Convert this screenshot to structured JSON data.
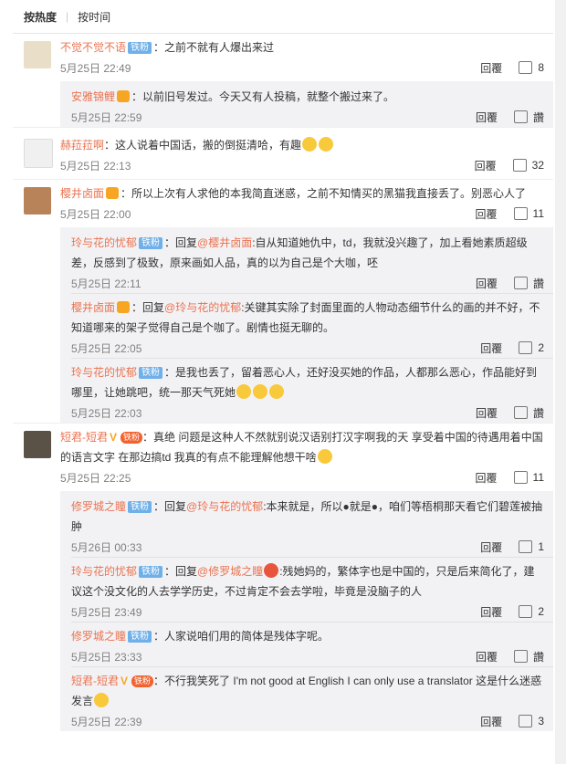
{
  "sort": {
    "hot": "按热度",
    "time": "按时间"
  },
  "comments": [
    {
      "name": "不觉不觉不语",
      "badge": "铁粉",
      "text": "：之前不就有人爆出来过",
      "time": "5月25日 22:49",
      "reply": "回覆",
      "likes": "8",
      "replies": [
        {
          "name": "安雅锦鲤",
          "badge": "",
          "text": "：以前旧号发过。今天又有人投稿，就整个搬过来了。",
          "time": "5月25日 22:59",
          "reply": "回覆",
          "likes": "讚"
        }
      ]
    },
    {
      "name": "赫菈菈啊",
      "badge": "",
      "text": "：这人说着中国话，搬的倒挺清哈，有趣",
      "time": "5月25日 22:13",
      "reply": "回覆",
      "likes": "32",
      "replies": []
    },
    {
      "name": "樱井卤面",
      "badge": "",
      "text": "：所以上次有人求他的本我简直迷惑，之前不知情买的黑猫我直接丢了。别恶心人了",
      "time": "5月25日 22:00",
      "reply": "回覆",
      "likes": "11",
      "replies": [
        {
          "name": "玲与花的忧郁",
          "badge": "铁粉",
          "pre": "：回复",
          "at": "@樱井卤面",
          "text": ":自从知道她仇中，td，我就没兴趣了，加上看她素质超级差，反感到了极致，原来画如人品，真的以为自己是个大咖，呸",
          "time": "5月25日 22:11",
          "reply": "回覆",
          "likes": "讚"
        },
        {
          "name": "樱井卤面",
          "badge": "",
          "pre": "：回复",
          "at": "@玲与花的忧郁",
          "text": ":关键其实除了封面里面的人物动态细节什么的画的并不好，不知道哪来的架子觉得自己是个咖了。剧情也挺无聊的。",
          "time": "5月25日 22:05",
          "reply": "回覆",
          "likes": "2"
        },
        {
          "name": "玲与花的忧郁",
          "badge": "铁粉",
          "pre": "",
          "at": "",
          "text": "：是我也丢了，留着恶心人，还好没买她的作品，人都那么恶心，作品能好到哪里，让她跳吧，统一那天气死她",
          "time": "5月25日 22:03",
          "reply": "回覆",
          "likes": "讚"
        }
      ]
    },
    {
      "name": "短君-短君",
      "badge": "",
      "fan": "铁粉",
      "text": "：真绝 问题是这种人不然就别说汉语别打汉字啊我的天 享受着中国的待遇用着中国的语言文字 在那边搞td 我真的有点不能理解他想干啥",
      "time": "5月25日 22:25",
      "reply": "回覆",
      "likes": "11",
      "replies": [
        {
          "name": "修罗城之瞳",
          "badge": "铁粉",
          "pre": "：回复",
          "at": "@玲与花的忧郁",
          "text": ":本来就是，所以●就是●，咱们等梧桐那天看它们碧莲被抽肿",
          "time": "5月26日 00:33",
          "reply": "回覆",
          "likes": "1"
        },
        {
          "name": "玲与花的忧郁",
          "badge": "铁粉",
          "pre": "：回复",
          "at": "@修罗城之瞳",
          "text": ":残她妈的，繁体字也是中国的，只是后来简化了，建议这个没文化的人去学学历史，不过肯定不会去学啦，毕竟是没脑子的人",
          "time": "5月25日 23:49",
          "reply": "回覆",
          "likes": "2"
        },
        {
          "name": "修罗城之瞳",
          "badge": "铁粉",
          "pre": "",
          "at": "",
          "text": "：人家说咱们用的简体是残体字呢。",
          "time": "5月25日 23:33",
          "reply": "回覆",
          "likes": "讚"
        },
        {
          "name": "短君-短君",
          "badge": "",
          "fan": "铁粉",
          "pre": "",
          "at": "",
          "text": "：不行我笑死了 I'm not good at English I can only use a translator 这是什么迷惑发言",
          "time": "5月25日 22:39",
          "reply": "回覆",
          "likes": "3"
        }
      ]
    }
  ]
}
